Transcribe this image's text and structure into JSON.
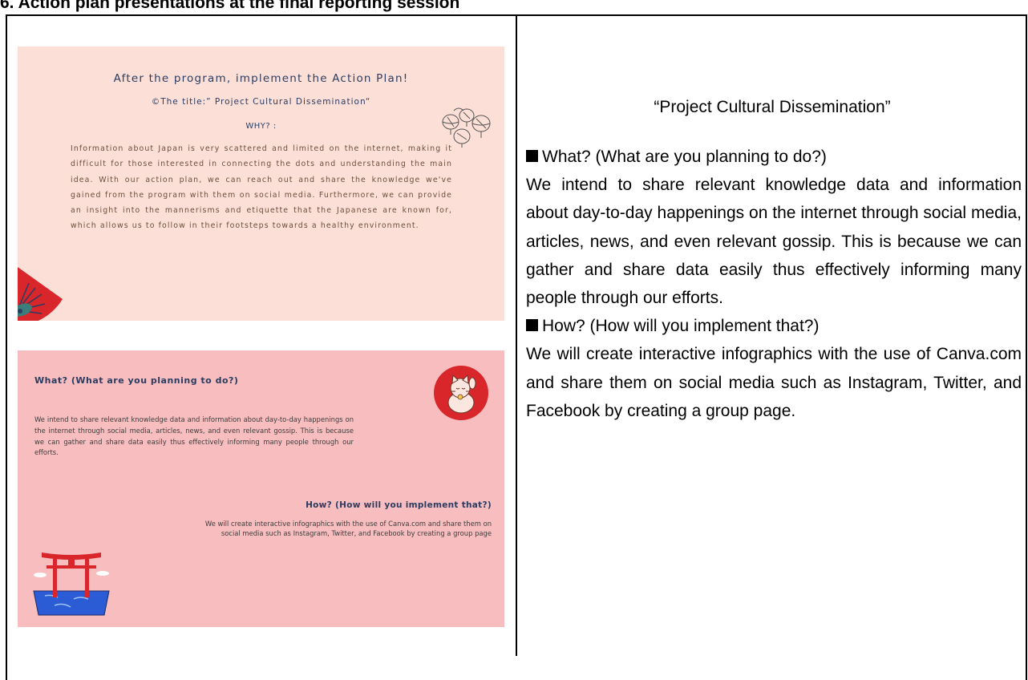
{
  "heading": "6. Action plan presentations at the final reporting session",
  "slide1": {
    "title": "After the program, implement the Action Plan!",
    "subtitle": "©The title:” Project Cultural Dissemination“",
    "why": "WHY? :",
    "body": "Information about Japan is very scattered and limited on the internet, making it difficult for those interested in connecting the dots and understanding the main idea. With our action plan, we can reach out and share the knowledge we've gained from the program with them on social media. Furthermore, we can provide an insight into the mannerisms and etiquette that the Japanese are known for, which allows us to follow in their footsteps towards a healthy environment."
  },
  "slide2": {
    "what_heading": "What? (What are you planning to do?)",
    "what_body": "We intend to share relevant knowledge data and information about day-to-day happenings on the internet through social media, articles, news, and even relevant gossip. This is because we can gather and share data easily thus effectively informing many people through our efforts.",
    "how_heading": "How? (How will you implement that?)",
    "how_body": "We will create interactive infographics with the use of Canva.com and share them on social media such as Instagram, Twitter, and Facebook by creating a group page"
  },
  "right": {
    "title": "“Project Cultural Dissemination”",
    "what_heading": "What? (What are you planning to do?)",
    "what_body": "We intend to share relevant knowledge data and information about day-to-day happenings on the internet through social media, articles, news, and even relevant gossip. This is because we can gather and share data easily thus effectively informing many people through our efforts.",
    "how_heading": "How? (How will you implement that?)",
    "how_body": "We will create interactive infographics with the use of Canva.com and share them on social media such as Instagram, Twitter, and Facebook by creating a group page."
  },
  "icons": {
    "lanterns": "lanterns-icon",
    "fan": "fan-icon",
    "cat": "lucky-cat-icon",
    "torii": "torii-gate-icon",
    "square": "square-bullet-icon"
  },
  "colors": {
    "slide1_bg": "#fce0d8",
    "slide2_bg": "#f8bebf",
    "accent_red": "#d8262a",
    "navy_text": "#2b3c62"
  }
}
